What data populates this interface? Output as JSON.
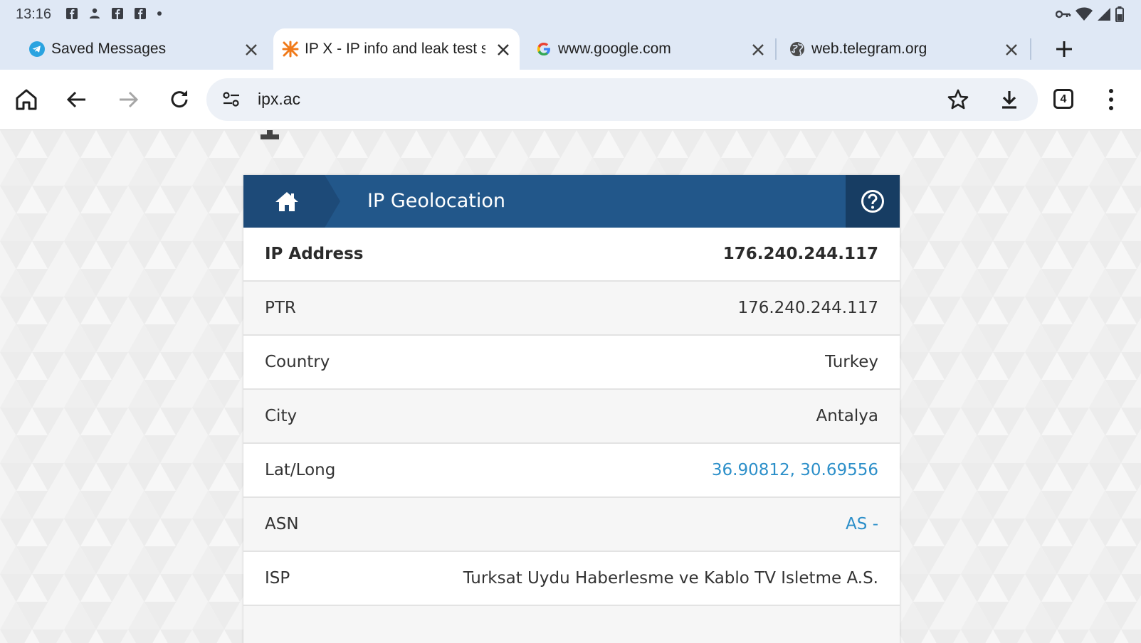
{
  "status_bar": {
    "time": "13:16"
  },
  "tabs": [
    {
      "title": "Saved Messages",
      "favicon": "telegram-icon",
      "active": false
    },
    {
      "title": "IP X - IP info and leak test su",
      "favicon": "ipx-icon",
      "active": true
    },
    {
      "title": "www.google.com",
      "favicon": "google-icon",
      "active": false
    },
    {
      "title": "web.telegram.org",
      "favicon": "globe-icon",
      "active": false
    }
  ],
  "toolbar": {
    "url": "ipx.ac",
    "tab_count": "4"
  },
  "card": {
    "title": "IP Geolocation",
    "rows": [
      {
        "label": "IP Address",
        "value": "176.240.244.117"
      },
      {
        "label": "PTR",
        "value": "176.240.244.117"
      },
      {
        "label": "Country",
        "value": "Turkey"
      },
      {
        "label": "City",
        "value": "Antalya"
      },
      {
        "label": "Lat/Long",
        "value": "36.90812, 30.69556"
      },
      {
        "label": "ASN",
        "value": "AS -"
      },
      {
        "label": "ISP",
        "value": "Turksat Uydu Haberlesme ve Kablo TV Isletme A.S."
      }
    ]
  },
  "colors": {
    "header_blue": "#22578a",
    "link_blue": "#2c8fc9",
    "tab_strip": "#dfe8f5"
  }
}
